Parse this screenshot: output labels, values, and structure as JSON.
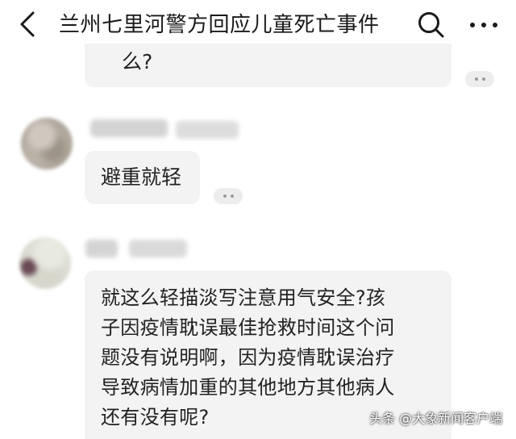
{
  "header": {
    "title": "兰州七里河警方回应儿童死亡事件",
    "back_icon": "chevron-left-icon",
    "search_icon": "search-icon",
    "more_icon": "more-horizontal-icon"
  },
  "comments": [
    {
      "text": "么?"
    },
    {
      "text": "避重就轻"
    },
    {
      "lines": [
        "就这么轻描淡写注意用气安全?孩",
        "子因疫情耽误最佳抢救时间这个问",
        "题没有说明啊，因为疫情耽误治疗",
        "导致病情加重的其他地方其他病人",
        "还有没有呢?"
      ]
    }
  ],
  "watermark": "头条 @大象新闻客户端",
  "colors": {
    "bubble_bg": "#f3f3f3",
    "text": "#222222",
    "background": "#ffffff"
  }
}
